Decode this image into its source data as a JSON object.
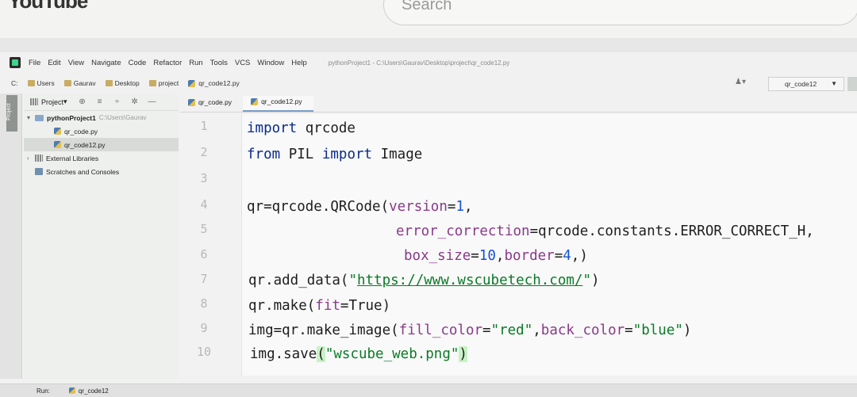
{
  "browser": {
    "logo": "YouTube",
    "search_placeholder": "Search"
  },
  "menu": [
    "File",
    "Edit",
    "View",
    "Navigate",
    "Code",
    "Refactor",
    "Run",
    "Tools",
    "VCS",
    "Window",
    "Help"
  ],
  "window_title": "pythonProject1 - C:\\Users\\Gaurav\\Desktop\\project\\qr_code12.py",
  "breadcrumbs": [
    "C:",
    "Users",
    "Gaurav",
    "Desktop",
    "project",
    "qr_code12.py"
  ],
  "run_config": "qr_code12",
  "project_panel": {
    "title": "Project",
    "tree": [
      {
        "label": "pythonProject1",
        "hint": "C:\\Users\\Gaurav",
        "type": "folder",
        "level": 0
      },
      {
        "label": "qr_code.py",
        "type": "py",
        "level": 1
      },
      {
        "label": "qr_code12.py",
        "type": "py",
        "level": 1,
        "selected": true
      },
      {
        "label": "External Libraries",
        "type": "lib",
        "level": 0
      },
      {
        "label": "Scratches and Consoles",
        "type": "scratch",
        "level": 0
      }
    ]
  },
  "editor_tabs": [
    {
      "label": "qr_code.py",
      "active": false
    },
    {
      "label": "qr_code12.py",
      "active": true
    }
  ],
  "code": {
    "line_numbers": [
      "1",
      "2",
      "3",
      "4",
      "5",
      "6",
      "7",
      "8",
      "9",
      "10"
    ],
    "l1_kw": "import",
    "l1_rest": " qrcode",
    "l2_kw1": "from",
    "l2_mid": " PIL ",
    "l2_kw2": "import",
    "l2_rest": " Image",
    "l4_a": "qr=qrcode.QRCode(",
    "l4_p": "version",
    "l4_eq": "=",
    "l4_n": "1",
    "l4_end": ",",
    "l5_p": "error_correction",
    "l5_rest": "=qrcode.constants.ERROR_CORRECT_H,",
    "l6_p1": "box_size",
    "l6_eq1": "=",
    "l6_n1": "10",
    "l6_sep": ",",
    "l6_p2": "border",
    "l6_eq2": "=",
    "l6_n2": "4",
    "l6_end": ",)",
    "l7_a": "qr.add_data(",
    "l7_q1": "\"",
    "l7_url": "https://www.wscubetech.com/",
    "l7_q2": "\"",
    "l7_end": ")",
    "l8_a": "qr.make(",
    "l8_p": "fit",
    "l8_rest": "=True)",
    "l9_a": "img=qr.make_image(",
    "l9_p1": "fill_color",
    "l9_eq1": "=",
    "l9_s1": "\"red\"",
    "l9_sep": ",",
    "l9_p2": "back_color",
    "l9_eq2": "=",
    "l9_s2": "\"blue\"",
    "l9_end": ")",
    "l10_a": "img.save",
    "l10_po": "(",
    "l10_s": "\"wscube_web.png\"",
    "l10_pc": ")"
  },
  "run_bar": {
    "label": "Run:",
    "config": "qr_code12"
  }
}
